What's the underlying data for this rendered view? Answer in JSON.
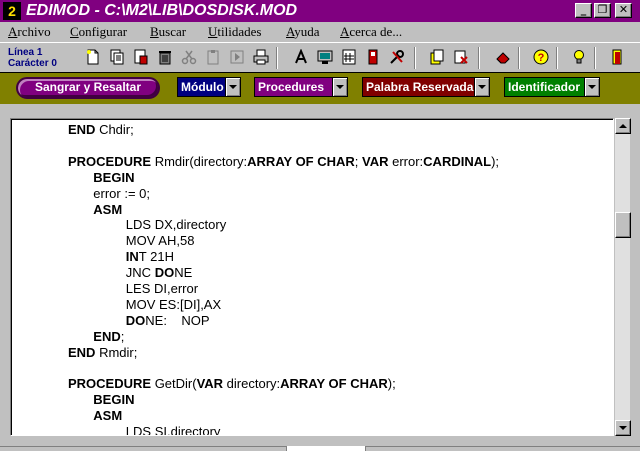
{
  "window": {
    "logo": "2",
    "title": "EDIMOD - C:\\M2\\LIB\\DOSDISK.MOD",
    "controls": {
      "minimize": "_",
      "restore": "❐",
      "close": "✕"
    }
  },
  "menu": {
    "items": [
      {
        "accel": "A",
        "rest": "rchivo"
      },
      {
        "accel": "C",
        "rest": "onfigurar"
      },
      {
        "accel": "B",
        "rest": "uscar"
      },
      {
        "accel": "U",
        "rest": "tilidades"
      },
      {
        "accel": "A",
        "rest": "yuda"
      },
      {
        "accel": "A",
        "rest": "cerca de..."
      }
    ]
  },
  "toolbar": {
    "line_label": "Línea 1",
    "col_label": "Carácter 0",
    "icons": [
      "new-file-icon",
      "copy-file-icon",
      "save-file-icon",
      "delete-icon",
      "cut-icon",
      "paste-icon",
      "run-icon",
      "print-icon",
      "font-icon",
      "monitor-icon",
      "calculator-icon",
      "compile-icon",
      "tools-icon",
      "copy-block-icon",
      "paste-block-icon",
      "eraser-icon",
      "help-icon",
      "tip-icon",
      "exit-icon"
    ]
  },
  "filters": {
    "indent_button": "Sangrar y Resaltar",
    "combos": [
      {
        "label": "Módulo",
        "color": "#000080"
      },
      {
        "label": "Procedures",
        "color": "#800080"
      },
      {
        "label": "Palabra Reservada",
        "color": "#800000"
      },
      {
        "label": "Identificador",
        "color": "#008000"
      }
    ]
  },
  "code": {
    "lines": [
      [
        [
          "k",
          "END"
        ],
        [
          "t",
          " Chdir;"
        ]
      ],
      [],
      [
        [
          "k",
          "PROCEDURE"
        ],
        [
          "t",
          " Rmdir(directory:"
        ],
        [
          "k",
          "ARRAY OF CHAR"
        ],
        [
          "t",
          "; "
        ],
        [
          "k",
          "VAR"
        ],
        [
          "t",
          " error:"
        ],
        [
          "k",
          "CARDINAL"
        ],
        [
          "t",
          ");"
        ]
      ],
      [
        [
          "t",
          "       "
        ],
        [
          "k",
          "BEGIN"
        ]
      ],
      [
        [
          "t",
          "       error := 0;"
        ]
      ],
      [
        [
          "t",
          "       "
        ],
        [
          "k",
          "ASM"
        ]
      ],
      [
        [
          "t",
          "                LDS DX,directory"
        ]
      ],
      [
        [
          "t",
          "                MOV AH,58"
        ]
      ],
      [
        [
          "t",
          "                "
        ],
        [
          "k",
          "IN"
        ],
        [
          "t",
          "T 21H"
        ]
      ],
      [
        [
          "t",
          "                JNC "
        ],
        [
          "k",
          "DO"
        ],
        [
          "t",
          "NE"
        ]
      ],
      [
        [
          "t",
          "                LES DI,error"
        ]
      ],
      [
        [
          "t",
          "                MOV ES:[DI],AX"
        ]
      ],
      [
        [
          "t",
          "                "
        ],
        [
          "k",
          "DO"
        ],
        [
          "t",
          "NE:    NOP"
        ]
      ],
      [
        [
          "t",
          "       "
        ],
        [
          "k",
          "END"
        ],
        [
          "t",
          ";"
        ]
      ],
      [
        [
          "k",
          "END"
        ],
        [
          "t",
          " Rmdir;"
        ]
      ],
      [],
      [
        [
          "k",
          "PROCEDURE"
        ],
        [
          "t",
          " GetDir("
        ],
        [
          "k",
          "VAR"
        ],
        [
          "t",
          " directory:"
        ],
        [
          "k",
          "ARRAY OF CHAR"
        ],
        [
          "t",
          ");"
        ]
      ],
      [
        [
          "t",
          "       "
        ],
        [
          "k",
          "BEGIN"
        ]
      ],
      [
        [
          "t",
          "       "
        ],
        [
          "k",
          "ASM"
        ]
      ],
      [
        [
          "t",
          "                LDS SI,directory"
        ]
      ]
    ]
  },
  "scroll": {
    "position_fraction": 0.3
  }
}
